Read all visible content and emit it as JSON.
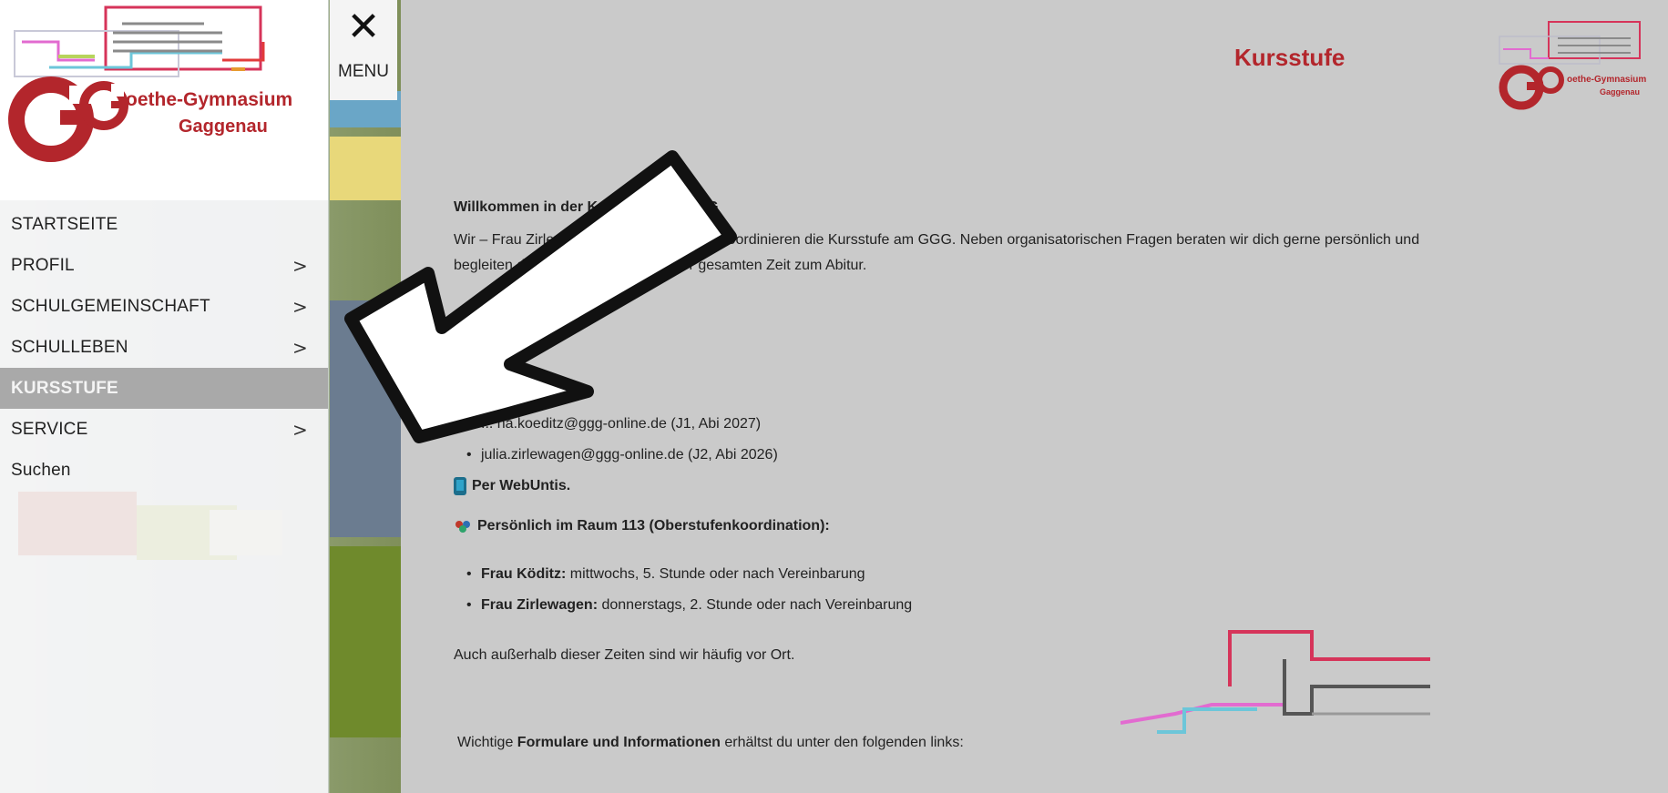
{
  "school": {
    "logo_big_line1": "oethe-Gymnasium",
    "logo_big_line2": "Gaggenau",
    "logo_small_line1": "oethe-Gymnasium",
    "logo_small_line2": "Gaggenau"
  },
  "menu_toggle": {
    "icon": "close-icon",
    "label": "MENU"
  },
  "nav": {
    "items": [
      {
        "label": "STARTSEITE",
        "has_submenu": false,
        "active": false
      },
      {
        "label": "PROFIL",
        "has_submenu": true,
        "active": false
      },
      {
        "label": "SCHULGEMEINSCHAFT",
        "has_submenu": true,
        "active": false
      },
      {
        "label": "SCHULLEBEN",
        "has_submenu": true,
        "active": false
      },
      {
        "label": "KURSSTUFE",
        "has_submenu": false,
        "active": true
      },
      {
        "label": "SERVICE",
        "has_submenu": true,
        "active": false
      },
      {
        "label": "Suchen",
        "has_submenu": false,
        "active": false
      }
    ],
    "chevron": ">"
  },
  "page": {
    "title": "Kursstufe",
    "welcome": "Willkommen in der Kursstufe am GGG",
    "intro_line1": "Wir – Frau Zirlewagen und Frau Köditz – koordinieren die Kursstufe am GGG. Neben organisatorischen Fragen beraten wir dich gerne persönlich und",
    "intro_line2": "begleiten dich auf deinem Weg in der gesamten Zeit zum Abitur.",
    "emails": [
      "... na.koeditz@ggg-online.de (J1, Abi 2027)",
      "julia.zirlewagen@ggg-online.de (J2, Abi 2026)"
    ],
    "webuntis": "Per WebUntis.",
    "room": "Persönlich im Raum 113 (Oberstufenkoordination):",
    "times": [
      {
        "name": "Frau Köditz:",
        "text": " mittwochs, 5. Stunde oder nach Vereinbarung"
      },
      {
        "name": "Frau Zirlewagen:",
        "text": " donnerstags, 2. Stunde oder nach Vereinbarung"
      }
    ],
    "note": "Auch außerhalb dieser Zeiten sind wir häufig vor Ort.",
    "forms_prefix": "Wichtige ",
    "forms_bold": "Formulare und Informationen",
    "forms_suffix": " erhältst du unter den folgenden links:"
  },
  "colors": {
    "brand_red": "#b3262c",
    "active_nav_bg": "#a9a9a9",
    "content_bg": "#cacaca"
  }
}
